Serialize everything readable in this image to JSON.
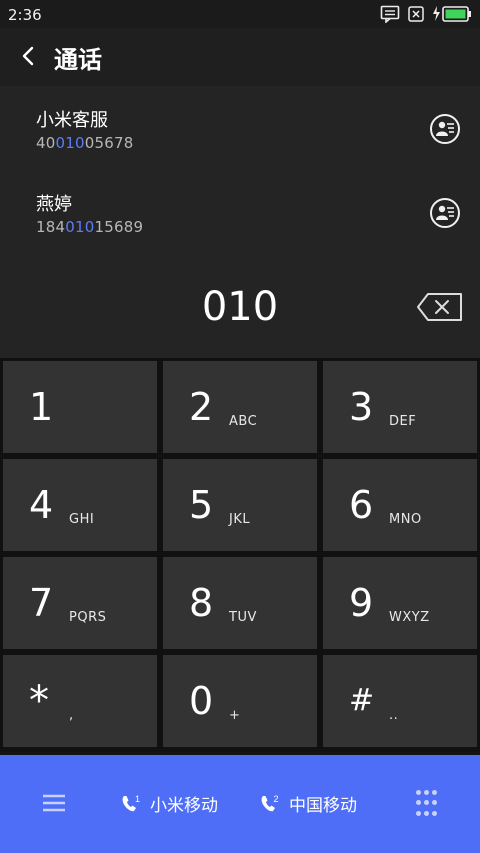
{
  "status": {
    "time": "2:36"
  },
  "header": {
    "title": "通话"
  },
  "contacts": [
    {
      "name": "小米客服",
      "number_prefix": "40",
      "number_match": "010",
      "number_suffix": "05678"
    },
    {
      "name": "燕婷",
      "number_prefix": "184",
      "number_match": "010",
      "number_suffix": "15689"
    }
  ],
  "dialed": "010",
  "keys": [
    {
      "digit": "1",
      "letters": ""
    },
    {
      "digit": "2",
      "letters": "ABC"
    },
    {
      "digit": "3",
      "letters": "DEF"
    },
    {
      "digit": "4",
      "letters": "GHI"
    },
    {
      "digit": "5",
      "letters": "JKL"
    },
    {
      "digit": "6",
      "letters": "MNO"
    },
    {
      "digit": "7",
      "letters": "PQRS"
    },
    {
      "digit": "8",
      "letters": "TUV"
    },
    {
      "digit": "9",
      "letters": "WXYZ"
    },
    {
      "digit": "*",
      "letters": ","
    },
    {
      "digit": "0",
      "letters": "+"
    },
    {
      "digit": "#",
      "letters": ".."
    }
  ],
  "bottom": {
    "sim1_label": "小米移动",
    "sim1_badge": "1",
    "sim2_label": "中国移动",
    "sim2_badge": "2"
  },
  "colors": {
    "accent": "#4e6ef8",
    "match": "#5b7cf6"
  }
}
